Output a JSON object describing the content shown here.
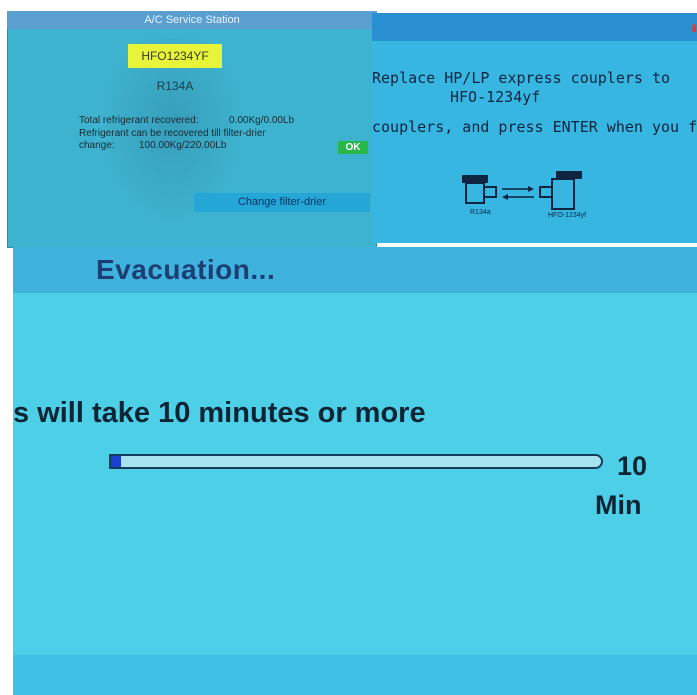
{
  "panel1": {
    "title": "A/C Service Station",
    "refrigerant_selected": "HFO1234YF",
    "refrigerant_alt": "R134A",
    "total_recovered_label": "Total refrigerant recovered:",
    "total_recovered_value": "0.00Kg/0.00Lb",
    "recover_until_line1": "Refrigerant can be recovered till filter-drier",
    "recover_until_line2": "change:",
    "recover_until_value": "100.00Kg/220.00Lb",
    "ok_label": "OK",
    "change_filter_label": "Change filter-drier"
  },
  "panel2": {
    "line1": "Replace HP/LP express couplers to",
    "line2": "HFO-1234yf",
    "line3": "couplers, and press ENTER when you finis",
    "label_left": "R134a",
    "label_right": "HFO-1234yf"
  },
  "panel3": {
    "title": "Evacuation...",
    "message": "s will take 10 minutes or more",
    "progress": 0.02,
    "value": "10",
    "unit": "Min"
  },
  "colors": {
    "selected_highlight": "#e8f43a",
    "ok_button": "#28b84a",
    "progress_fill": "#1b3fd0"
  }
}
